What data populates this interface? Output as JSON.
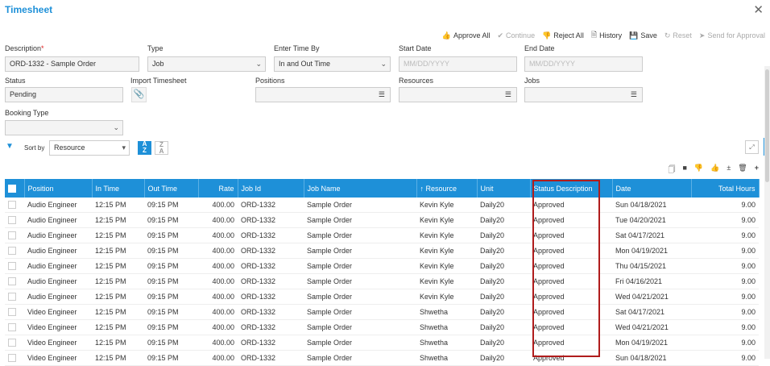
{
  "window": {
    "title": "Timesheet"
  },
  "toolbar": {
    "approve_all": "Approve All",
    "continue": "Continue",
    "reject_all": "Reject All",
    "history": "History",
    "save": "Save",
    "reset": "Reset",
    "send_for_approval": "Send for Approval"
  },
  "form": {
    "description_label": "Description",
    "description_value": "ORD-1332 - Sample Order",
    "type_label": "Type",
    "type_value": "Job",
    "enter_time_by_label": "Enter Time By",
    "enter_time_by_value": "In and Out Time",
    "start_date_label": "Start Date",
    "start_date_placeholder": "MM/DD/YYYY",
    "end_date_label": "End Date",
    "end_date_placeholder": "MM/DD/YYYY",
    "status_label": "Status",
    "status_value": "Pending",
    "import_label": "Import Timesheet",
    "positions_label": "Positions",
    "resources_label": "Resources",
    "jobs_label": "Jobs",
    "booking_type_label": "Booking Type",
    "booking_type_value": ""
  },
  "sort": {
    "label": "Sort by",
    "value": "Resource"
  },
  "grid": {
    "columns": [
      "Position",
      "In Time",
      "Out Time",
      "Rate",
      "Job Id",
      "Job Name",
      "↑ Resource",
      "Unit",
      "Status Description",
      "Date",
      "Total Hours"
    ],
    "rows": [
      [
        "Audio Engineer",
        "12:15 PM",
        "09:15 PM",
        "400.00",
        "ORD-1332",
        "Sample Order",
        "Kevin Kyle",
        "Daily20",
        "Approved",
        "Sun 04/18/2021",
        "9.00"
      ],
      [
        "Audio Engineer",
        "12:15 PM",
        "09:15 PM",
        "400.00",
        "ORD-1332",
        "Sample Order",
        "Kevin Kyle",
        "Daily20",
        "Approved",
        "Tue 04/20/2021",
        "9.00"
      ],
      [
        "Audio Engineer",
        "12:15 PM",
        "09:15 PM",
        "400.00",
        "ORD-1332",
        "Sample Order",
        "Kevin Kyle",
        "Daily20",
        "Approved",
        "Sat 04/17/2021",
        "9.00"
      ],
      [
        "Audio Engineer",
        "12:15 PM",
        "09:15 PM",
        "400.00",
        "ORD-1332",
        "Sample Order",
        "Kevin Kyle",
        "Daily20",
        "Approved",
        "Mon 04/19/2021",
        "9.00"
      ],
      [
        "Audio Engineer",
        "12:15 PM",
        "09:15 PM",
        "400.00",
        "ORD-1332",
        "Sample Order",
        "Kevin Kyle",
        "Daily20",
        "Approved",
        "Thu 04/15/2021",
        "9.00"
      ],
      [
        "Audio Engineer",
        "12:15 PM",
        "09:15 PM",
        "400.00",
        "ORD-1332",
        "Sample Order",
        "Kevin Kyle",
        "Daily20",
        "Approved",
        "Fri 04/16/2021",
        "9.00"
      ],
      [
        "Audio Engineer",
        "12:15 PM",
        "09:15 PM",
        "400.00",
        "ORD-1332",
        "Sample Order",
        "Kevin Kyle",
        "Daily20",
        "Approved",
        "Wed 04/21/2021",
        "9.00"
      ],
      [
        "Video Engineer",
        "12:15 PM",
        "09:15 PM",
        "400.00",
        "ORD-1332",
        "Sample Order",
        "Shwetha",
        "Daily20",
        "Approved",
        "Sat 04/17/2021",
        "9.00"
      ],
      [
        "Video Engineer",
        "12:15 PM",
        "09:15 PM",
        "400.00",
        "ORD-1332",
        "Sample Order",
        "Shwetha",
        "Daily20",
        "Approved",
        "Wed 04/21/2021",
        "9.00"
      ],
      [
        "Video Engineer",
        "12:15 PM",
        "09:15 PM",
        "400.00",
        "ORD-1332",
        "Sample Order",
        "Shwetha",
        "Daily20",
        "Approved",
        "Mon 04/19/2021",
        "9.00"
      ],
      [
        "Video Engineer",
        "12:15 PM",
        "09:15 PM",
        "400.00",
        "ORD-1332",
        "Sample Order",
        "Shwetha",
        "Daily20",
        "Approved",
        "Sun 04/18/2021",
        "9.00"
      ]
    ]
  },
  "icons": {
    "approve": "thumbs-up-icon",
    "continue": "check-icon",
    "reject": "thumbs-down-icon",
    "history": "history-icon",
    "save": "save-icon",
    "reset": "reset-icon",
    "send": "send-icon"
  },
  "colors": {
    "accent": "#1e90d8",
    "highlight_border": "#b01c1c",
    "required": "#e02020"
  }
}
